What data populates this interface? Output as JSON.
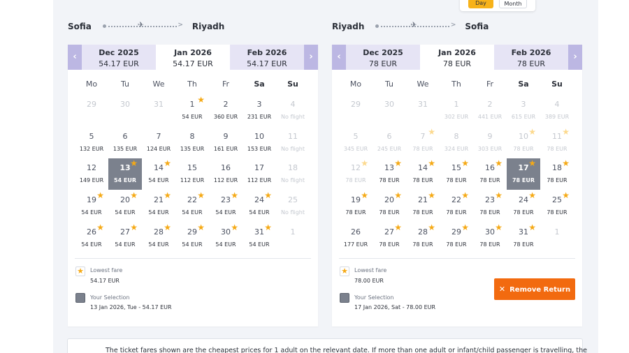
{
  "toggle": {
    "day": "Day",
    "month": "Month"
  },
  "weekdays": [
    "Mo",
    "Tu",
    "We",
    "Th",
    "Fr",
    "Sa",
    "Su"
  ],
  "outbound": {
    "from": "Sofia",
    "to": "Riyadh",
    "months": [
      {
        "name": "Dec 2025",
        "price": "54.17 EUR"
      },
      {
        "name": "Jan 2026",
        "price": "54.17 EUR"
      },
      {
        "name": "Feb 2026",
        "price": "54.17 EUR"
      }
    ],
    "days": [
      {
        "d": "29",
        "p": "",
        "s": false,
        "x": true
      },
      {
        "d": "30",
        "p": "",
        "s": false,
        "x": true
      },
      {
        "d": "31",
        "p": "",
        "s": false,
        "x": true
      },
      {
        "d": "1",
        "p": "54 EUR",
        "s": true,
        "x": false
      },
      {
        "d": "2",
        "p": "360 EUR",
        "s": false,
        "x": false
      },
      {
        "d": "3",
        "p": "231 EUR",
        "s": false,
        "x": false
      },
      {
        "d": "4",
        "p": "No flight",
        "s": false,
        "x": true
      },
      {
        "d": "5",
        "p": "132 EUR",
        "s": false,
        "x": false
      },
      {
        "d": "6",
        "p": "135 EUR",
        "s": false,
        "x": false
      },
      {
        "d": "7",
        "p": "124 EUR",
        "s": false,
        "x": false
      },
      {
        "d": "8",
        "p": "135 EUR",
        "s": false,
        "x": false
      },
      {
        "d": "9",
        "p": "161 EUR",
        "s": false,
        "x": false
      },
      {
        "d": "10",
        "p": "153 EUR",
        "s": false,
        "x": false
      },
      {
        "d": "11",
        "p": "No flight",
        "s": false,
        "x": true
      },
      {
        "d": "12",
        "p": "149 EUR",
        "s": false,
        "x": false
      },
      {
        "d": "13",
        "p": "54 EUR",
        "s": true,
        "x": false,
        "sel": true
      },
      {
        "d": "14",
        "p": "54 EUR",
        "s": true,
        "x": false
      },
      {
        "d": "15",
        "p": "112 EUR",
        "s": false,
        "x": false
      },
      {
        "d": "16",
        "p": "112 EUR",
        "s": false,
        "x": false
      },
      {
        "d": "17",
        "p": "112 EUR",
        "s": false,
        "x": false
      },
      {
        "d": "18",
        "p": "No flight",
        "s": false,
        "x": true
      },
      {
        "d": "19",
        "p": "54 EUR",
        "s": true,
        "x": false
      },
      {
        "d": "20",
        "p": "54 EUR",
        "s": true,
        "x": false
      },
      {
        "d": "21",
        "p": "54 EUR",
        "s": true,
        "x": false
      },
      {
        "d": "22",
        "p": "54 EUR",
        "s": true,
        "x": false
      },
      {
        "d": "23",
        "p": "54 EUR",
        "s": true,
        "x": false
      },
      {
        "d": "24",
        "p": "54 EUR",
        "s": true,
        "x": false
      },
      {
        "d": "25",
        "p": "No flight",
        "s": false,
        "x": true
      },
      {
        "d": "26",
        "p": "54 EUR",
        "s": true,
        "x": false
      },
      {
        "d": "27",
        "p": "54 EUR",
        "s": true,
        "x": false
      },
      {
        "d": "28",
        "p": "54 EUR",
        "s": true,
        "x": false
      },
      {
        "d": "29",
        "p": "54 EUR",
        "s": true,
        "x": false
      },
      {
        "d": "30",
        "p": "54 EUR",
        "s": true,
        "x": false
      },
      {
        "d": "31",
        "p": "54 EUR",
        "s": true,
        "x": false
      },
      {
        "d": "1",
        "p": "",
        "s": false,
        "x": true
      }
    ],
    "legend": {
      "lowest_title": "Lowest fare",
      "lowest_value": "54.17 EUR",
      "sel_title": "Your Selection",
      "sel_value": "13 Jan 2026, Tue - 54.17 EUR"
    }
  },
  "return": {
    "from": "Riyadh",
    "to": "Sofia",
    "months": [
      {
        "name": "Dec 2025",
        "price": "78 EUR"
      },
      {
        "name": "Jan 2026",
        "price": "78 EUR"
      },
      {
        "name": "Feb 2026",
        "price": "78 EUR"
      }
    ],
    "days": [
      {
        "d": "29",
        "p": "",
        "s": false,
        "x": true
      },
      {
        "d": "30",
        "p": "",
        "s": false,
        "x": true
      },
      {
        "d": "31",
        "p": "",
        "s": false,
        "x": true
      },
      {
        "d": "1",
        "p": "302 EUR",
        "s": false,
        "x": true
      },
      {
        "d": "2",
        "p": "441 EUR",
        "s": false,
        "x": true
      },
      {
        "d": "3",
        "p": "615 EUR",
        "s": false,
        "x": true
      },
      {
        "d": "4",
        "p": "389 EUR",
        "s": false,
        "x": true
      },
      {
        "d": "5",
        "p": "345 EUR",
        "s": false,
        "x": true
      },
      {
        "d": "6",
        "p": "245 EUR",
        "s": false,
        "x": true
      },
      {
        "d": "7",
        "p": "78 EUR",
        "s": true,
        "x": true
      },
      {
        "d": "8",
        "p": "324 EUR",
        "s": false,
        "x": true
      },
      {
        "d": "9",
        "p": "303 EUR",
        "s": false,
        "x": true
      },
      {
        "d": "10",
        "p": "78 EUR",
        "s": true,
        "x": true
      },
      {
        "d": "11",
        "p": "78 EUR",
        "s": true,
        "x": true
      },
      {
        "d": "12",
        "p": "78 EUR",
        "s": true,
        "x": true
      },
      {
        "d": "13",
        "p": "78 EUR",
        "s": true,
        "x": false
      },
      {
        "d": "14",
        "p": "78 EUR",
        "s": true,
        "x": false
      },
      {
        "d": "15",
        "p": "78 EUR",
        "s": true,
        "x": false
      },
      {
        "d": "16",
        "p": "78 EUR",
        "s": true,
        "x": false
      },
      {
        "d": "17",
        "p": "78 EUR",
        "s": true,
        "x": false,
        "sel": true
      },
      {
        "d": "18",
        "p": "78 EUR",
        "s": true,
        "x": false
      },
      {
        "d": "19",
        "p": "78 EUR",
        "s": true,
        "x": false
      },
      {
        "d": "20",
        "p": "78 EUR",
        "s": true,
        "x": false
      },
      {
        "d": "21",
        "p": "78 EUR",
        "s": true,
        "x": false
      },
      {
        "d": "22",
        "p": "78 EUR",
        "s": true,
        "x": false
      },
      {
        "d": "23",
        "p": "78 EUR",
        "s": true,
        "x": false
      },
      {
        "d": "24",
        "p": "78 EUR",
        "s": true,
        "x": false
      },
      {
        "d": "25",
        "p": "78 EUR",
        "s": true,
        "x": false
      },
      {
        "d": "26",
        "p": "177 EUR",
        "s": false,
        "x": false
      },
      {
        "d": "27",
        "p": "78 EUR",
        "s": true,
        "x": false
      },
      {
        "d": "28",
        "p": "78 EUR",
        "s": true,
        "x": false
      },
      {
        "d": "29",
        "p": "78 EUR",
        "s": true,
        "x": false
      },
      {
        "d": "30",
        "p": "78 EUR",
        "s": true,
        "x": false
      },
      {
        "d": "31",
        "p": "78 EUR",
        "s": true,
        "x": false
      },
      {
        "d": "1",
        "p": "",
        "s": false,
        "x": true
      }
    ],
    "legend": {
      "lowest_title": "Lowest fare",
      "lowest_value": "78.00 EUR",
      "sel_title": "Your Selection",
      "sel_value": "17 Jan 2026, Sat - 78.00 EUR"
    },
    "remove_label": "Remove Return"
  },
  "notice_text": "The ticket fares shown are the cheapest prices for 1 adult on the relevant date. If more than one adult or infant/child passenger is travelling, the"
}
